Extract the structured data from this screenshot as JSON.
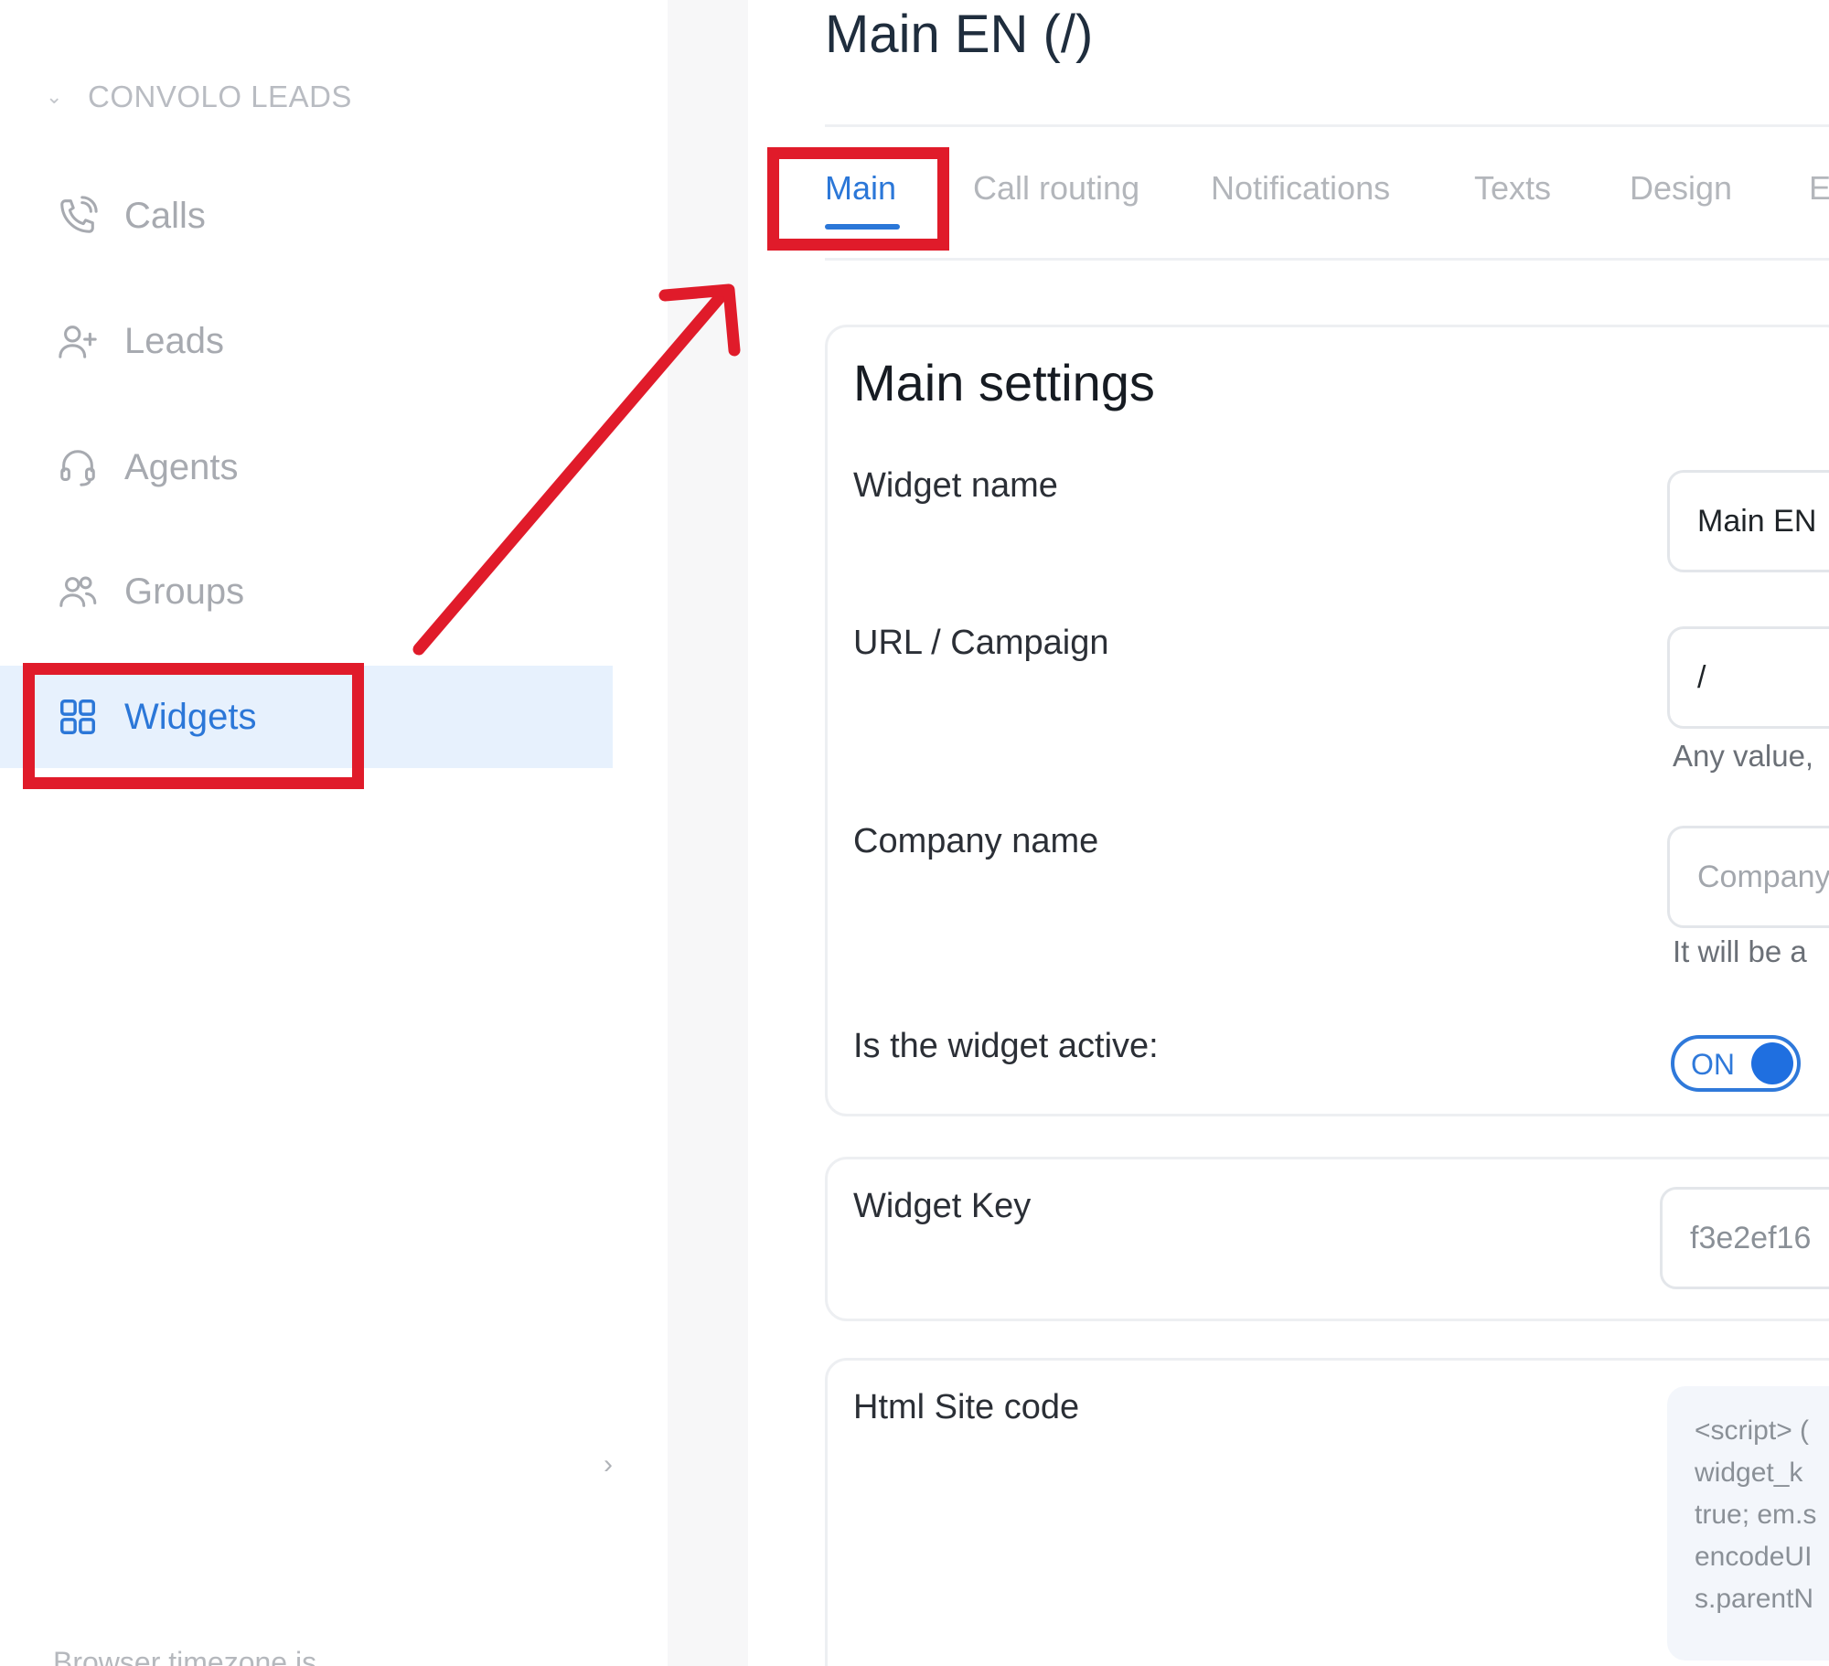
{
  "sidebar": {
    "section_label": "CONVOLO LEADS",
    "items": [
      {
        "label": "Calls"
      },
      {
        "label": "Leads"
      },
      {
        "label": "Agents"
      },
      {
        "label": "Groups"
      },
      {
        "label": "Widgets"
      }
    ],
    "active_item": "Widgets",
    "footer_text": "Browser timezone is"
  },
  "page": {
    "title": "Main EN (/)"
  },
  "tabs": [
    {
      "label": "Main"
    },
    {
      "label": "Call routing"
    },
    {
      "label": "Notifications"
    },
    {
      "label": "Texts"
    },
    {
      "label": "Design"
    },
    {
      "label": "E"
    }
  ],
  "active_tab": "Main",
  "main_settings": {
    "title": "Main settings",
    "widget_name": {
      "label": "Widget name",
      "value": "Main  EN"
    },
    "url_campaign": {
      "label": "URL / Campaign",
      "value": "/",
      "hint": "Any value,"
    },
    "company_name": {
      "label": "Company name",
      "placeholder": "Company",
      "hint": "It will be a"
    },
    "active": {
      "label": "Is the widget active:",
      "state": "ON"
    }
  },
  "widget_key": {
    "label": "Widget Key",
    "value": "f3e2ef16"
  },
  "html_site_code": {
    "label": "Html Site code",
    "lines": [
      "<script> (",
      "widget_k",
      "true; em.s",
      "encodeUI",
      "s.parentN"
    ]
  },
  "colors": {
    "accent": "#2b77d8",
    "active_bg": "#e7f1fd",
    "annotation": "#e01b2a"
  }
}
